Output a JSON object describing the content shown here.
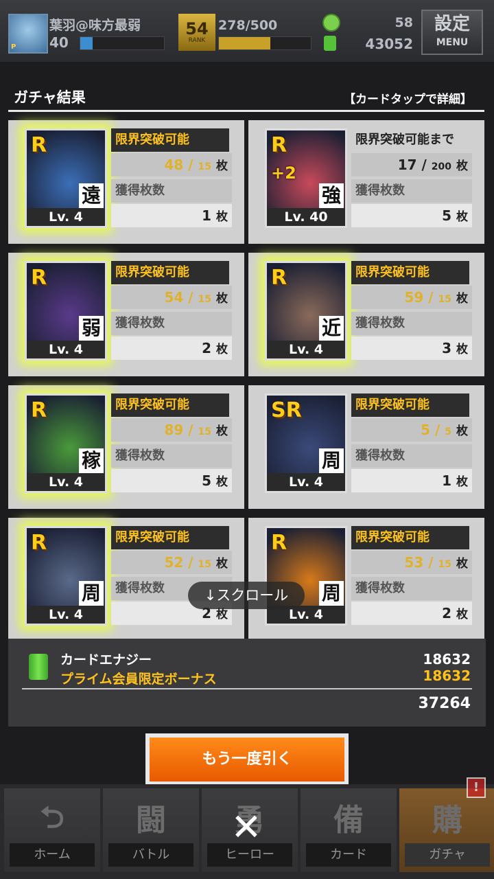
{
  "player": {
    "name": "葉羽@味方最弱",
    "level": "40",
    "rank": "54",
    "rank_label": "RANK",
    "stamina": "278/500",
    "coins": "58",
    "energy": "43052",
    "xp_fill": 0.15,
    "stamina_fill": 0.56
  },
  "menu": {
    "kanji": "設定",
    "label": "MENU"
  },
  "header": {
    "title": "ガチャ結果",
    "note": "【カードタップで詳細】"
  },
  "cards": [
    {
      "rarity": "R",
      "type": "遠",
      "level": "Lv. 4",
      "status": "限界突破可能",
      "have": "48",
      "need": "15",
      "unit": "枚",
      "acq_label": "獲得枚数",
      "acquired": "1",
      "glow": true,
      "color": "#3b6fb8"
    },
    {
      "rarity": "R",
      "type": "強",
      "level": "Lv. 40",
      "plus": "+2",
      "status": "限界突破可能まで",
      "have": "17",
      "need": "200",
      "unit": "枚",
      "acq_label": "獲得枚数",
      "acquired": "5",
      "glow": false,
      "color": "#c84a5a"
    },
    {
      "rarity": "R",
      "type": "弱",
      "level": "Lv. 4",
      "status": "限界突破可能",
      "have": "54",
      "need": "15",
      "unit": "枚",
      "acq_label": "獲得枚数",
      "acquired": "2",
      "glow": true,
      "color": "#5a3a8a"
    },
    {
      "rarity": "R",
      "type": "近",
      "level": "Lv. 4",
      "status": "限界突破可能",
      "have": "59",
      "need": "15",
      "unit": "枚",
      "acq_label": "獲得枚数",
      "acquired": "3",
      "glow": true,
      "color": "#8a6a5a"
    },
    {
      "rarity": "R",
      "type": "稼",
      "level": "Lv. 4",
      "status": "限界突破可能",
      "have": "89",
      "need": "15",
      "unit": "枚",
      "acq_label": "獲得枚数",
      "acquired": "5",
      "glow": true,
      "color": "#4a9a3a"
    },
    {
      "rarity": "SR",
      "type": "周",
      "level": "Lv. 4",
      "status": "限界突破可能",
      "have": "5",
      "need": "5",
      "unit": "枚",
      "acq_label": "獲得枚数",
      "acquired": "1",
      "glow": false,
      "color": "#3a4a7a"
    },
    {
      "rarity": "R",
      "type": "周",
      "level": "Lv. 4",
      "status": "限界突破可能",
      "have": "52",
      "need": "15",
      "unit": "枚",
      "acq_label": "獲得枚数",
      "acquired": "2",
      "glow": true,
      "color": "#5a6a8a"
    },
    {
      "rarity": "R",
      "type": "周",
      "level": "Lv. 4",
      "status": "限界突破可能",
      "have": "53",
      "need": "15",
      "unit": "枚",
      "acq_label": "獲得枚数",
      "acquired": "2",
      "glow": false,
      "color": "#d87a1a"
    }
  ],
  "scroll_hint": "↓スクロール",
  "energy_panel": {
    "label": "カードエナジー",
    "bonus_label": "プライム会員限定ボーナス",
    "value": "18632",
    "bonus_value": "18632",
    "total": "37264"
  },
  "again_button": "もう一度引く",
  "nav": [
    {
      "label": "ホーム",
      "icon": "home-icon",
      "glyph": "⮌"
    },
    {
      "label": "バトル",
      "icon": "battle-icon",
      "glyph": "闘"
    },
    {
      "label": "ヒーロー",
      "icon": "hero-icon",
      "glyph": "勇"
    },
    {
      "label": "カード",
      "icon": "card-icon",
      "glyph": "備"
    },
    {
      "label": "ガチャ",
      "icon": "gacha-icon",
      "glyph": "購"
    }
  ],
  "nav_alert": "!",
  "close_glyph": "✕"
}
